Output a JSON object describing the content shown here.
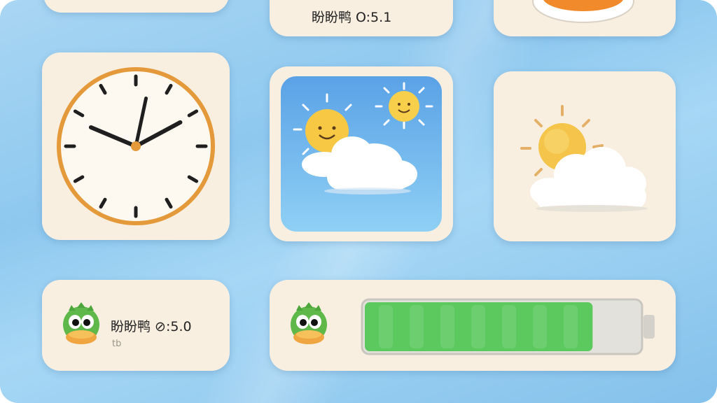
{
  "widgets": {
    "top_center": {
      "title": "盼盼鸭 O:5.1"
    },
    "pet_small": {
      "title": "盼盼鸭 ⊘:5.0",
      "subtitle": "tb"
    },
    "clock": {
      "hour": 10,
      "minute": 2
    },
    "battery": {
      "level_fraction": 0.83,
      "fill_color": "#5cc95e"
    }
  },
  "icons": {
    "clock": "analog-clock-icon",
    "weather_app": "sun-cloud-weather-icon",
    "weather": "partly-cloudy-icon",
    "pet": "green-duck-mascot-icon",
    "battery": "battery-icon"
  },
  "colors": {
    "background": "#9fd1f2",
    "widget": "#f8efe1",
    "clock_ring": "#e59a3a",
    "sun": "#f6cd4a"
  }
}
